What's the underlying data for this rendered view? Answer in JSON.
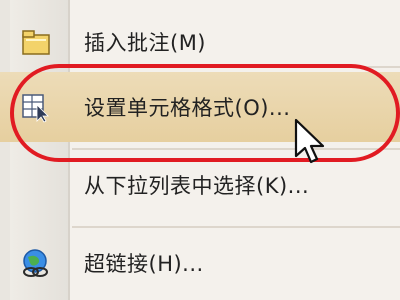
{
  "context_menu": {
    "items": [
      {
        "label": "插入批注(M)",
        "icon": "comment-folder-icon"
      },
      {
        "label": "设置单元格格式(O)...",
        "icon": "format-cells-icon",
        "highlighted": true
      },
      {
        "label": "从下拉列表中选择(K)...",
        "icon": ""
      },
      {
        "label": "超链接(H)...",
        "icon": "globe-link-icon"
      }
    ],
    "highlight_color": "#e11b22",
    "hover_color": "#e6cf9f"
  }
}
